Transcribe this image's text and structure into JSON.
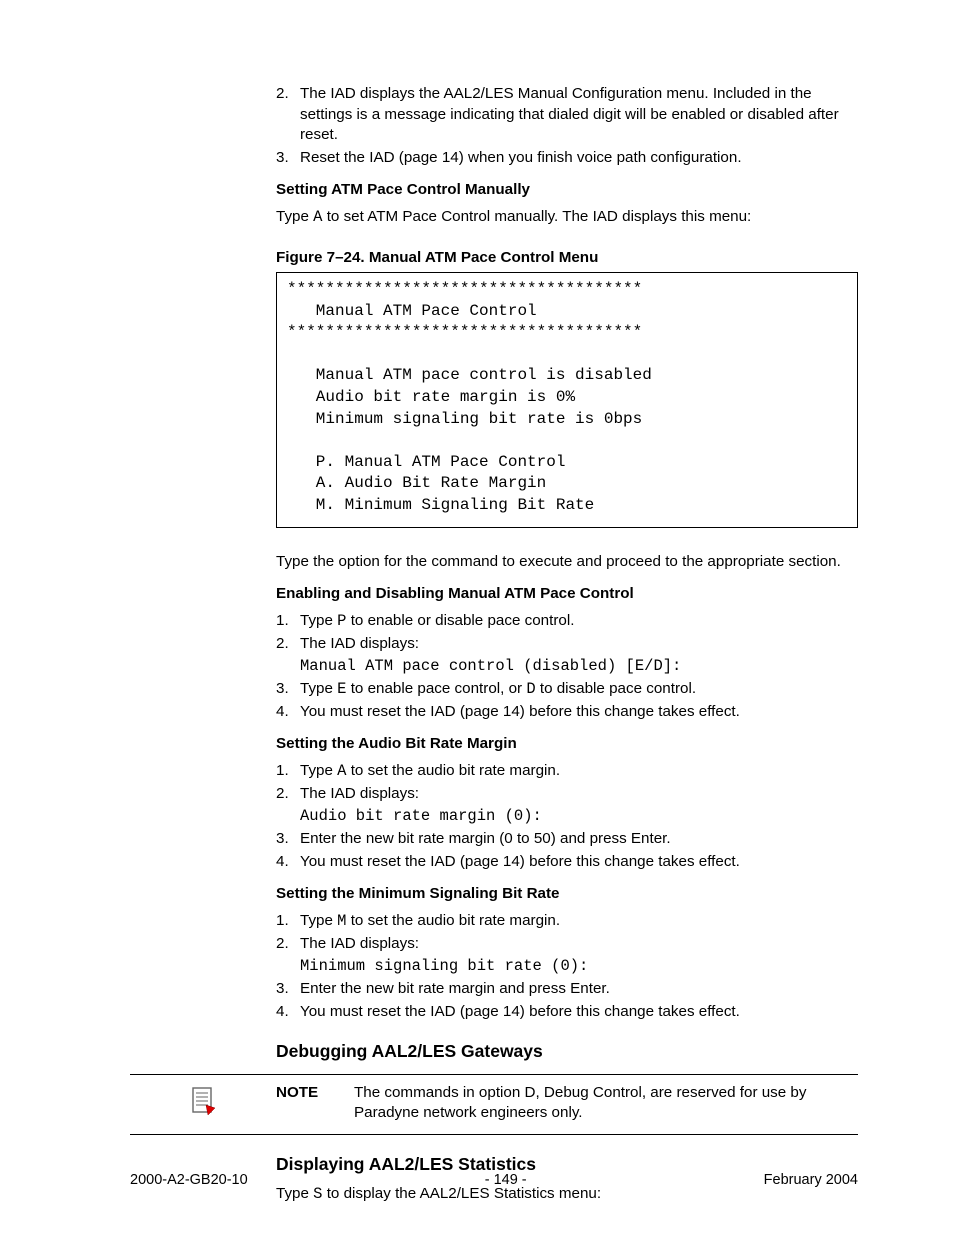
{
  "list_top": [
    {
      "n": "2.",
      "text": "The IAD displays the AAL2/LES Manual Configuration menu. Included in the settings is a message indicating that dialed digit will be enabled or disabled after reset."
    },
    {
      "n": "3.",
      "text": "Reset the IAD (page 14) when you finish voice path configuration."
    }
  ],
  "h_setting_atm": "Setting ATM Pace Control Manually",
  "p_setting_atm_a": "Type ",
  "p_setting_atm_code": "A",
  "p_setting_atm_b": " to set ATM Pace Control manually. The IAD displays this menu:",
  "fig_caption": "Figure 7–24.  Manual ATM Pace Control Menu",
  "code_box": "*************************************\n   Manual ATM Pace Control\n*************************************\n\n   Manual ATM pace control is disabled\n   Audio bit rate margin is 0%\n   Minimum signaling bit rate is 0bps\n\n   P. Manual ATM Pace Control\n   A. Audio Bit Rate Margin\n   M. Minimum Signaling Bit Rate",
  "p_after_box": "Type the option for the command to execute and proceed to the appropriate section.",
  "h_enable_disable": "Enabling and Disabling Manual ATM Pace Control",
  "ed": {
    "i1a": "Type ",
    "i1code": "P",
    "i1b": " to enable or disable pace control.",
    "i2": "The IAD displays:",
    "i2code": "Manual ATM pace control (disabled) [E/D]:",
    "i3a": "Type ",
    "i3code1": "E",
    "i3mid": " to enable pace control, or ",
    "i3code2": "D",
    "i3b": " to disable pace control.",
    "i4": "You must reset the IAD (page 14) before this change takes effect."
  },
  "h_audio": "Setting the Audio Bit Rate Margin",
  "audio": {
    "i1a": "Type ",
    "i1code": "A",
    "i1b": " to set the audio bit rate margin.",
    "i2": "The IAD displays:",
    "i2code": "Audio bit rate margin (0):",
    "i3": "Enter the new bit rate margin (0 to 50) and press Enter.",
    "i4": "You must reset the IAD (page 14) before this change takes effect."
  },
  "h_min": "Setting the Minimum Signaling Bit Rate",
  "min": {
    "i1a": "Type ",
    "i1code": "M",
    "i1b": " to set the audio bit rate margin.",
    "i2": "The IAD displays:",
    "i2code": "Minimum signaling bit rate (0):",
    "i3": "Enter the new bit rate margin and press Enter.",
    "i4": "You must reset the IAD (page 14) before this change takes effect."
  },
  "h_debug": "Debugging AAL2/LES Gateways",
  "note_label": "NOTE",
  "note_text": "The commands in option D, Debug Control, are reserved for use by Paradyne network engineers only.",
  "h_stats": "Displaying AAL2/LES Statistics",
  "p_stats_a": "Type ",
  "p_stats_code": "S",
  "p_stats_b": " to display the AAL2/LES Statistics menu:",
  "footer": {
    "left": "2000-A2-GB20-10",
    "center": "- 149 -",
    "right": "February 2004"
  }
}
